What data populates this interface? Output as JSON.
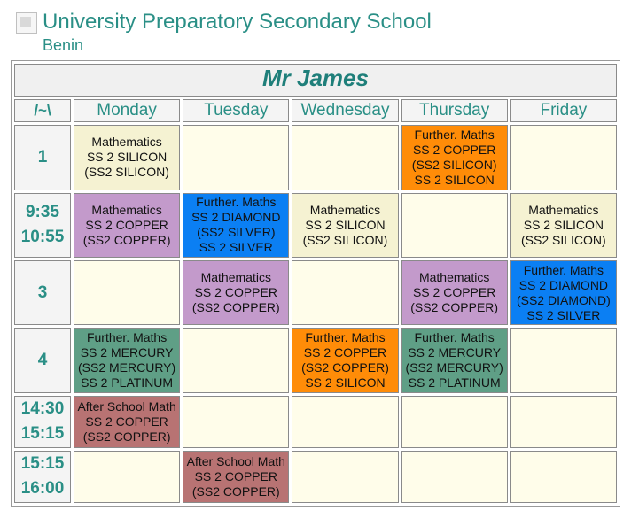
{
  "header": {
    "school_name": "University Preparatory Secondary School",
    "location": "Benin",
    "broken_image_icon": "broken-image-icon"
  },
  "timetable": {
    "teacher": "Mr James",
    "corner_label": "/~\\",
    "days": [
      "Monday",
      "Tuesday",
      "Wednesday",
      "Thursday",
      "Friday"
    ],
    "rows": [
      {
        "period": [
          "1"
        ],
        "cells": [
          {
            "color": "beige",
            "lines": [
              "Mathematics",
              "SS 2 SILICON",
              "(SS2 SILICON)"
            ]
          },
          {
            "color": "empty",
            "lines": []
          },
          {
            "color": "empty",
            "lines": []
          },
          {
            "color": "orange",
            "lines": [
              "Further. Maths",
              "SS 2 COPPER",
              "(SS2 SILICON)",
              "SS 2 SILICON"
            ]
          },
          {
            "color": "empty",
            "lines": []
          }
        ]
      },
      {
        "period": [
          "9:35",
          "10:55"
        ],
        "cells": [
          {
            "color": "purple",
            "lines": [
              "Mathematics",
              "SS 2 COPPER",
              "(SS2 COPPER)"
            ]
          },
          {
            "color": "blue",
            "lines": [
              "Further. Maths",
              "SS 2 DIAMOND",
              "(SS2 SILVER)",
              "SS 2 SILVER"
            ]
          },
          {
            "color": "beige",
            "lines": [
              "Mathematics",
              "SS 2 SILICON",
              "(SS2 SILICON)"
            ]
          },
          {
            "color": "empty",
            "lines": []
          },
          {
            "color": "beige",
            "lines": [
              "Mathematics",
              "SS 2 SILICON",
              "(SS2 SILICON)"
            ]
          }
        ]
      },
      {
        "period": [
          "3"
        ],
        "cells": [
          {
            "color": "empty",
            "lines": []
          },
          {
            "color": "purple",
            "lines": [
              "Mathematics",
              "SS 2 COPPER",
              "(SS2 COPPER)"
            ]
          },
          {
            "color": "empty",
            "lines": []
          },
          {
            "color": "purple",
            "lines": [
              "Mathematics",
              "SS 2 COPPER",
              "(SS2 COPPER)"
            ]
          },
          {
            "color": "blue",
            "lines": [
              "Further. Maths",
              "SS 2 DIAMOND",
              "(SS2 DIAMOND)",
              "SS 2 SILVER"
            ]
          }
        ]
      },
      {
        "period": [
          "4"
        ],
        "cells": [
          {
            "color": "green",
            "lines": [
              "Further. Maths",
              "SS 2 MERCURY",
              "(SS2 MERCURY)",
              "SS 2 PLATINUM"
            ]
          },
          {
            "color": "empty",
            "lines": []
          },
          {
            "color": "orange",
            "lines": [
              "Further. Maths",
              "SS 2 COPPER",
              "(SS2 COPPER)",
              "SS 2 SILICON"
            ]
          },
          {
            "color": "green",
            "lines": [
              "Further. Maths",
              "SS 2 MERCURY",
              "(SS2 MERCURY)",
              "SS 2 PLATINUM"
            ]
          },
          {
            "color": "empty",
            "lines": []
          }
        ]
      },
      {
        "period": [
          "14:30",
          "15:15"
        ],
        "cells": [
          {
            "color": "rose",
            "lines": [
              "After School Math",
              "SS 2 COPPER",
              "(SS2 COPPER)"
            ]
          },
          {
            "color": "empty",
            "lines": []
          },
          {
            "color": "empty",
            "lines": []
          },
          {
            "color": "empty",
            "lines": []
          },
          {
            "color": "empty",
            "lines": []
          }
        ]
      },
      {
        "period": [
          "15:15",
          "16:00"
        ],
        "cells": [
          {
            "color": "empty",
            "lines": []
          },
          {
            "color": "rose",
            "lines": [
              "After School Math",
              "SS 2 COPPER",
              "(SS2 COPPER)"
            ]
          },
          {
            "color": "empty",
            "lines": []
          },
          {
            "color": "empty",
            "lines": []
          },
          {
            "color": "empty",
            "lines": []
          }
        ]
      }
    ]
  },
  "colors": {
    "accent_teal": "#2a8f86",
    "empty": "#fffdea",
    "beige": "#f5f2d2",
    "purple": "#c39acb",
    "blue": "#0b7ff3",
    "orange": "#ff8c08",
    "green": "#5f9f86",
    "rose": "#b87373"
  }
}
